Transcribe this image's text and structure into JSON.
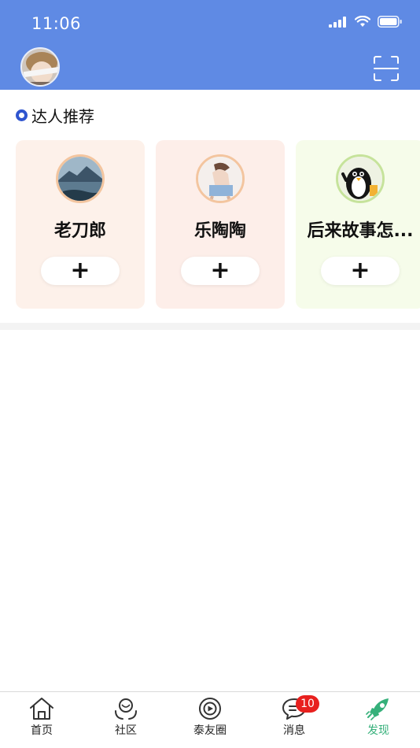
{
  "status_bar": {
    "time": "11:06"
  },
  "section": {
    "title": "达人推荐"
  },
  "recommend": {
    "cards": [
      {
        "name": "老刀郎",
        "follow_label": "+",
        "bg": "#fdf1ea"
      },
      {
        "name": "乐陶陶",
        "follow_label": "+",
        "bg": "#fdeee9"
      },
      {
        "name": "后来故事怎...",
        "follow_label": "+",
        "bg": "#f6fcea"
      }
    ]
  },
  "tabbar": {
    "items": [
      {
        "label": "首页",
        "icon": "home-icon"
      },
      {
        "label": "社区",
        "icon": "community-icon"
      },
      {
        "label": "泰友圈",
        "icon": "moments-icon"
      },
      {
        "label": "消息",
        "icon": "message-icon",
        "badge": "10"
      },
      {
        "label": "发现",
        "icon": "rocket-icon",
        "active": true
      }
    ]
  },
  "colors": {
    "header": "#5f8ae4",
    "accent_dot": "#2f55cf",
    "active_tab": "#35b07a",
    "badge": "#e8201e"
  }
}
